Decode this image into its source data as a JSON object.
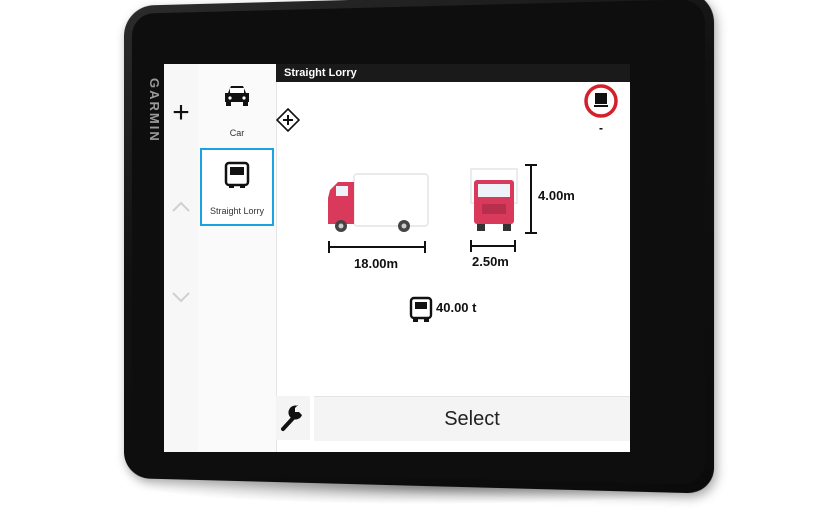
{
  "device": {
    "brand": "GARMIN"
  },
  "rail": {
    "add_symbol": "+"
  },
  "vehicles": [
    {
      "label": "Car",
      "icon": "car-icon",
      "selected": false
    },
    {
      "label": "Straight Lorry",
      "icon": "truck-icon",
      "selected": true
    }
  ],
  "header": {
    "title": "Straight Lorry"
  },
  "profile": {
    "length": "18.00m",
    "width": "2.50m",
    "height": "4.00m",
    "weight": "40.00 t"
  },
  "restriction_sign": {
    "icon": "no-trucks-sign-icon",
    "value": "-"
  },
  "actions": {
    "select_label": "Select",
    "settings_icon": "wrench-icon"
  },
  "colors": {
    "truck_cab": "#d93a5c",
    "selection_border": "#1aa3e0",
    "sign_red": "#d3202a"
  }
}
